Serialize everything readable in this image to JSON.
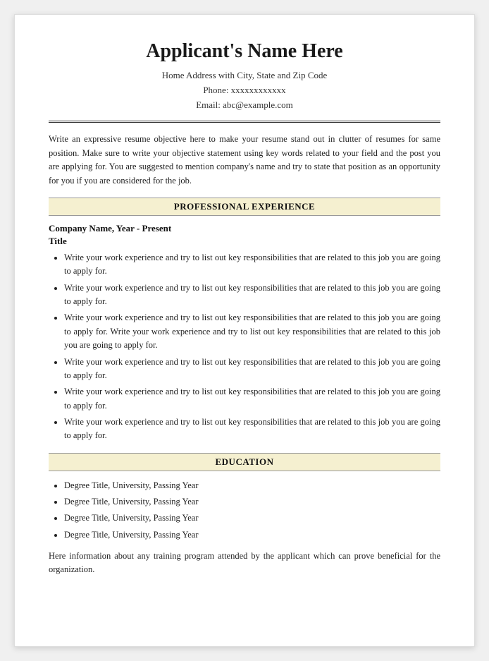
{
  "header": {
    "name": "Applicant's Name Here",
    "address": "Home Address with City, State and Zip Code",
    "phone": "Phone: xxxxxxxxxxxx",
    "email": "Email: abc@example.com"
  },
  "objective": {
    "text": "Write an expressive resume objective here to make your resume stand out in clutter of resumes for same position. Make sure to write your objective statement using key words related to your field and the post you are applying for. You are suggested to mention company's name and try to state that position as an opportunity for you if you are considered for the job."
  },
  "sections": {
    "professional_experience_label": "PROFESSIONAL EXPERIENCE",
    "education_label": "EDUCATION"
  },
  "experience": {
    "company": "Company Name, Year - Present",
    "title": "Title",
    "bullets": [
      "Write your work experience and try to list out key responsibilities that are related to this job you are going to apply for.",
      "Write your work experience and try to list out key responsibilities that are related to this job you are going to apply for.",
      "Write your work experience and try to list out key responsibilities that are related to this job you are going to apply for. Write your work experience and try to list out key responsibilities that are related to this job you are going to apply for.",
      "Write your work experience and try to list out key responsibilities that are related to this job you are going to apply for.",
      "Write your work experience and try to list out key responsibilities that are related to this job you are going to apply for.",
      "Write your work experience and try to list out key responsibilities that are related to this job you are going to apply for."
    ]
  },
  "education": {
    "degrees": [
      "Degree Title, University, Passing Year",
      "Degree Title, University, Passing Year",
      "Degree Title, University, Passing Year",
      "Degree Title, University, Passing Year"
    ],
    "training_text": "Here information about any training program attended by the applicant which can prove beneficial for the organization."
  }
}
